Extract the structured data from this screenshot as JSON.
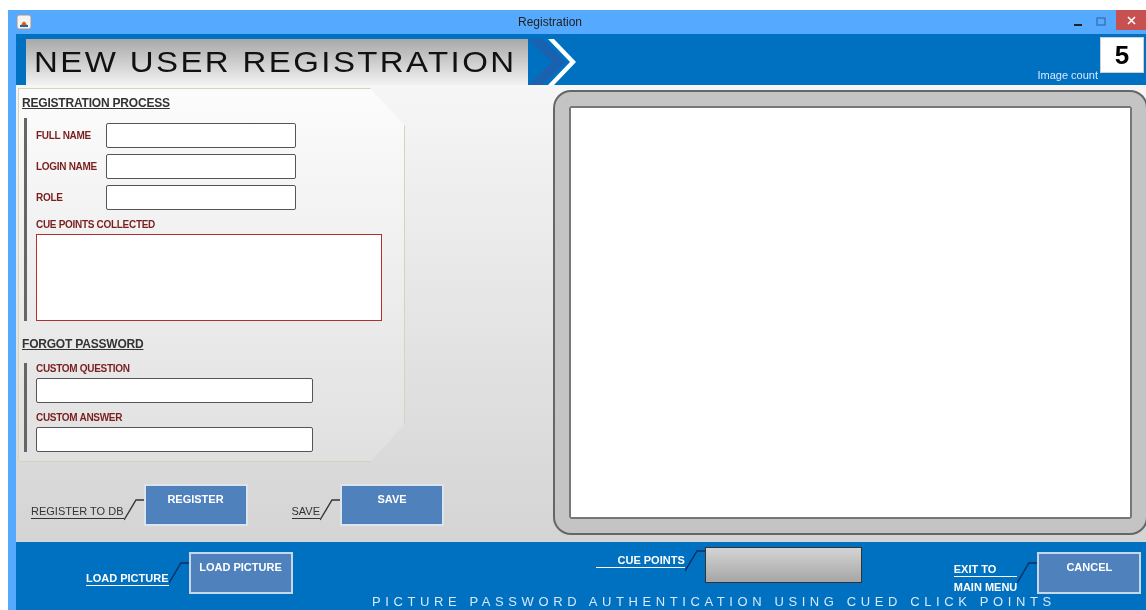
{
  "window": {
    "title": "Registration"
  },
  "banner": {
    "title": "NEW USER REGISTRATION"
  },
  "image_count": {
    "label": "Image count",
    "value": "5"
  },
  "registration": {
    "heading": "REGISTRATION PROCESS",
    "fields": [
      {
        "label": "FULL NAME",
        "kind": "row"
      },
      {
        "label": "LOGIN NAME",
        "kind": "row"
      },
      {
        "label": "ROLE",
        "kind": "row"
      },
      {
        "label": "CUE POINTS COLLECTED",
        "kind": "area"
      }
    ]
  },
  "forgot_password": {
    "heading": "FORGOT PASSWORD",
    "fields": [
      {
        "label": "CUSTOM QUESTION",
        "kind": "stacked"
      },
      {
        "label": "CUSTOM ANSWER",
        "kind": "stacked"
      }
    ]
  },
  "actions": [
    {
      "caption": "REGISTER TO DB",
      "button": "REGISTER"
    },
    {
      "caption": "SAVE",
      "button": "SAVE"
    }
  ],
  "bottom_bar": {
    "load": {
      "caption": "LOAD PICTURE",
      "button": "LOAD PICTURE"
    },
    "cue_points": {
      "caption": "CUE POINTS"
    },
    "exit": {
      "caption_lines": [
        "EXIT TO",
        "MAIN MENU"
      ],
      "button": "CANCEL"
    },
    "footer": "PICTURE PASSWORD AUTHENTICATION USING CUED CLICK POINTS"
  }
}
